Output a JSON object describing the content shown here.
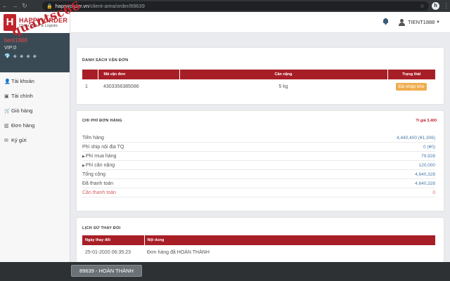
{
  "browser": {
    "url_host": "happyorder.vn",
    "url_path": "/client-area/order/89639",
    "profile_initial": "h"
  },
  "brand": {
    "name": "HAPPY ORDER",
    "tagline": "China Order & Logistic",
    "mark": "H",
    "watermark": "quantsc66"
  },
  "user": {
    "name": "tient1888",
    "vip": "VIP:0",
    "gems": "💎 ◈ ◈ ◈ ◈"
  },
  "menu": [
    {
      "label": "Tài khoản",
      "icon": "user-icon"
    },
    {
      "label": "Tài chính",
      "icon": "money-icon"
    },
    {
      "label": "Giỏ hàng",
      "icon": "cart-icon"
    },
    {
      "label": "Đơn hàng",
      "icon": "chart-icon"
    },
    {
      "label": "Ký gửi",
      "icon": "envelope-icon"
    }
  ],
  "header": {
    "username": "TIENT1888"
  },
  "shipments": {
    "title": "Danh sách vận đơn",
    "columns": [
      "",
      "Mã vận đơn",
      "Cân nặng",
      "Trạng thái"
    ],
    "rows": [
      {
        "index": "1",
        "code": "4303356385086",
        "weight": "5 kg",
        "status": "Đã nhập kho"
      }
    ]
  },
  "costs": {
    "title": "Chi phí đơn hàng",
    "rate": "Tỉ giá 3,400",
    "rows": [
      {
        "label": "Tiền hàng",
        "value": "4,440,400",
        "extra": "(¥1,306)"
      },
      {
        "label": "Phí ship nội địa TQ",
        "value": "0",
        "extra": "(¥0)"
      },
      {
        "label": "Phí mua hàng",
        "value": "79,928",
        "extra": ""
      },
      {
        "label": "Phí cân nặng",
        "value": "120,000",
        "extra": ""
      },
      {
        "label": "Tổng cộng",
        "value": "4,640,328",
        "extra": ""
      },
      {
        "label": "Đã thanh toán",
        "value": "4,640,328",
        "extra": ""
      },
      {
        "label": "Cần thanh toán",
        "value": "0",
        "extra": ""
      }
    ]
  },
  "history": {
    "title": "Lịch sử thay đổi",
    "columns": [
      "Ngày thay đổi",
      "Nội dung"
    ],
    "rows": [
      {
        "date": "25-01-2020 06:35:23",
        "content": "Đơn hàng đã HOÀN THÀNH"
      }
    ]
  },
  "status_bar": {
    "label": "89639 - HOÀN THÀNH"
  },
  "colors": {
    "primary": "#a81e27",
    "accent_red": "#c0232c",
    "badge_orange": "#f0ad4e",
    "value_blue": "#4a7ba8",
    "sidebar_user_bg": "#3a4a55"
  }
}
